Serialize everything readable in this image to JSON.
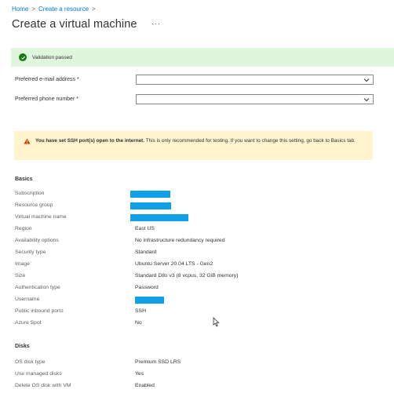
{
  "breadcrumb": {
    "home": "Home",
    "separator": ">",
    "create": "Create a resource"
  },
  "page_title": "Create a virtual machine",
  "more_label": "···",
  "validation": {
    "text": "Validation passed"
  },
  "fields": {
    "email": {
      "label": "Preferred e-mail address *",
      "value": ""
    },
    "phone": {
      "label": "Preferred phone number *",
      "value": ""
    }
  },
  "warning": {
    "bold": "You have set SSH port(s) open to the internet.",
    "text": " This is only recommended for testing.  If you want to change this setting, go back to Basics tab."
  },
  "basics": {
    "heading": "Basics",
    "rows": [
      {
        "label": "Subscription",
        "value": ""
      },
      {
        "label": "Resource group",
        "value": ""
      },
      {
        "label": "Virtual machine name",
        "value": ""
      },
      {
        "label": "Region",
        "value": "East US"
      },
      {
        "label": "Availability options",
        "value": "No infrastructure redundancy required"
      },
      {
        "label": "Security type",
        "value": "Standard"
      },
      {
        "label": "Image",
        "value": "Ubuntu Server 20.04 LTS - Gen2"
      },
      {
        "label": "Size",
        "value": "Standard D8s v3 (8 vcpus, 32 GiB memory)"
      },
      {
        "label": "Authentication type",
        "value": "Password"
      },
      {
        "label": "Username",
        "value": ""
      },
      {
        "label": "Public inbound ports",
        "value": "SSH"
      },
      {
        "label": "Azure Spot",
        "value": "No"
      }
    ]
  },
  "disks": {
    "heading": "Disks",
    "rows": [
      {
        "label": "OS disk type",
        "value": "Premium SSD LRS"
      },
      {
        "label": "Use managed disks",
        "value": "Yes"
      },
      {
        "label": "Delete OS disk with VM",
        "value": "Enabled"
      }
    ]
  },
  "colors": {
    "accent": "#0078d4",
    "success": "#107c10",
    "success_bg": "#dff6dd",
    "warning_bg": "#fff4ce",
    "warning_icon": "#d83b01",
    "redaction": "#0fa0e8"
  }
}
